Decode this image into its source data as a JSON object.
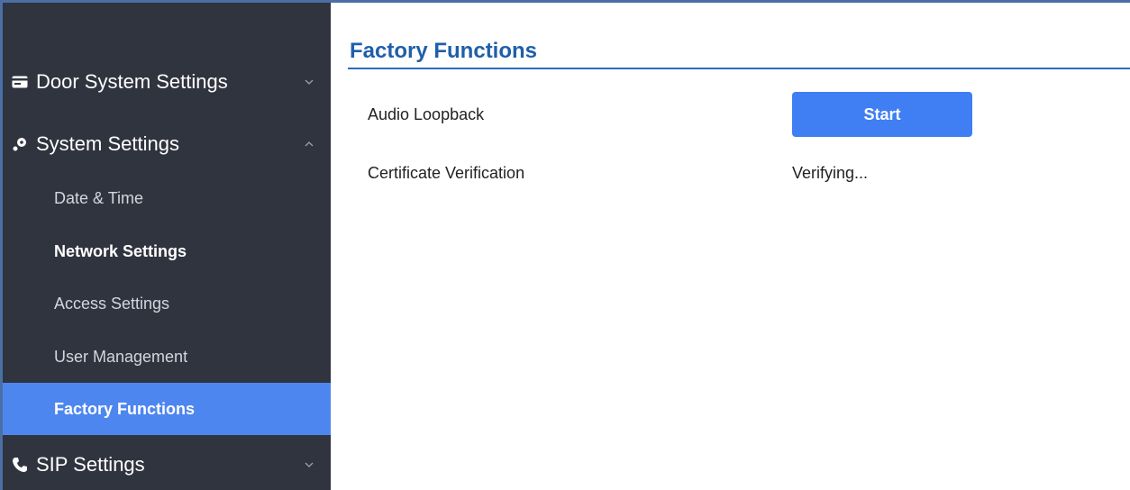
{
  "sidebar": {
    "groups": [
      {
        "label": "Door System Settings",
        "icon": "card-icon",
        "expanded": false
      },
      {
        "label": "System Settings",
        "icon": "key-icon",
        "expanded": true
      },
      {
        "label": "SIP Settings",
        "icon": "phone-icon",
        "expanded": false
      }
    ],
    "items": [
      {
        "label": "Date & Time"
      },
      {
        "label": "Network Settings"
      },
      {
        "label": "Access Settings"
      },
      {
        "label": "User Management"
      },
      {
        "label": "Factory Functions",
        "active": true
      }
    ]
  },
  "main": {
    "title": "Factory Functions",
    "rows": [
      {
        "label": "Audio Loopback",
        "button_label": "Start"
      },
      {
        "label": "Certificate Verification",
        "value": "Verifying..."
      }
    ]
  },
  "colors": {
    "sidebar_bg": "#30343f",
    "active_item": "#4e86f0",
    "title": "#1f5faa",
    "button": "#3f7ef3"
  }
}
